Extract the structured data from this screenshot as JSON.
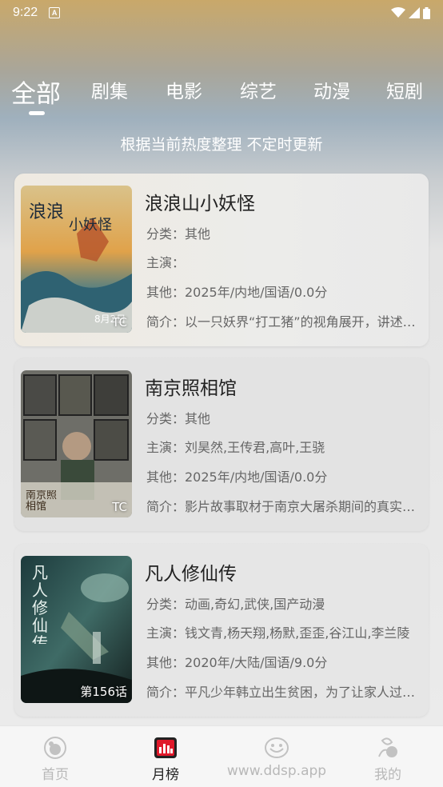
{
  "status_bar": {
    "time": "9:22",
    "badge": "A"
  },
  "tabs": [
    {
      "label": "全部"
    },
    {
      "label": "剧集"
    },
    {
      "label": "电影"
    },
    {
      "label": "综艺"
    },
    {
      "label": "动漫"
    },
    {
      "label": "短剧"
    }
  ],
  "subtitle": "根据当前热度整理 不定时更新",
  "cards": [
    {
      "title": "浪浪山小妖怪",
      "category": "分类：其他",
      "cast": "主演：",
      "other": "其他：2025年/内地/国语/0.0分",
      "intro": "简介：以一只妖界“打工猪”的视角展开，讲述了几个小妖怪的故事",
      "badge": "TC",
      "poster_text": "8月2日"
    },
    {
      "title": "南京照相馆",
      "category": "分类：其他",
      "cast": "主演：刘昊然,王传君,高叶,王骁",
      "other": "其他：2025年/内地/国语/0.0分",
      "intro": "简介：影片故事取材于南京大屠杀期间的真实历史",
      "badge": "TC",
      "poster_text": "南京照相馆"
    },
    {
      "title": "凡人修仙传",
      "category": "分类：动画,奇幻,武侠,国产动漫",
      "cast": "主演：钱文青,杨天翔,杨默,歪歪,谷江山,李兰陵",
      "other": "其他：2020年/大陆/国语/9.0分",
      "intro": "简介：平凡少年韩立出生贫困，为了让家人过上更好的生活",
      "badge": "第156话",
      "poster_text": "凡人修仙传"
    }
  ],
  "bottom_nav": [
    {
      "label": "首页",
      "icon": "home-icon"
    },
    {
      "label": "月榜",
      "icon": "chart-icon"
    },
    {
      "label": "www.ddsp.app",
      "icon": "face-icon"
    },
    {
      "label": "我的",
      "icon": "profile-icon"
    }
  ],
  "colors": {
    "accent": "#e0182a",
    "inactive": "#b8b8b8"
  }
}
